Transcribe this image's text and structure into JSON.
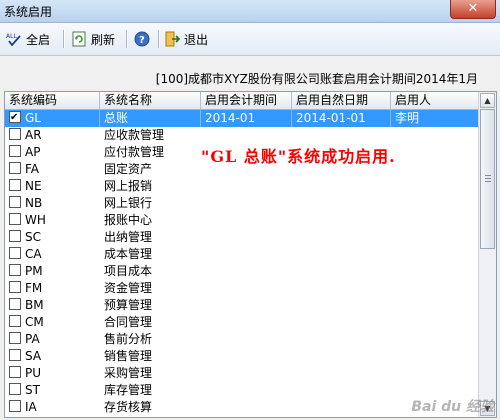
{
  "window": {
    "title": "系统启用",
    "close": "✕"
  },
  "toolbar": {
    "select_all": "全启",
    "refresh": "刷新",
    "exit": "退出",
    "all_icon_text": "ALL"
  },
  "info": "[100]成都市XYZ股份有限公司账套启用会计期间2014年1月",
  "columns": [
    "系统编码",
    "系统名称",
    "启用会计期间",
    "启用自然日期",
    "启用人"
  ],
  "rows": [
    {
      "code": "GL",
      "name": "总账",
      "period": "2014-01",
      "date": "2014-01-01",
      "user": "李明",
      "checked": true,
      "selected": true
    },
    {
      "code": "AR",
      "name": "应收款管理",
      "period": "",
      "date": "",
      "user": "",
      "checked": false
    },
    {
      "code": "AP",
      "name": "应付款管理",
      "period": "",
      "date": "",
      "user": "",
      "checked": false
    },
    {
      "code": "FA",
      "name": "固定资产",
      "period": "",
      "date": "",
      "user": "",
      "checked": false
    },
    {
      "code": "NE",
      "name": "网上报销",
      "period": "",
      "date": "",
      "user": "",
      "checked": false
    },
    {
      "code": "NB",
      "name": "网上银行",
      "period": "",
      "date": "",
      "user": "",
      "checked": false
    },
    {
      "code": "WH",
      "name": "报账中心",
      "period": "",
      "date": "",
      "user": "",
      "checked": false
    },
    {
      "code": "SC",
      "name": "出纳管理",
      "period": "",
      "date": "",
      "user": "",
      "checked": false
    },
    {
      "code": "CA",
      "name": "成本管理",
      "period": "",
      "date": "",
      "user": "",
      "checked": false
    },
    {
      "code": "PM",
      "name": "项目成本",
      "period": "",
      "date": "",
      "user": "",
      "checked": false
    },
    {
      "code": "FM",
      "name": "资金管理",
      "period": "",
      "date": "",
      "user": "",
      "checked": false
    },
    {
      "code": "BM",
      "name": "预算管理",
      "period": "",
      "date": "",
      "user": "",
      "checked": false
    },
    {
      "code": "CM",
      "name": "合同管理",
      "period": "",
      "date": "",
      "user": "",
      "checked": false
    },
    {
      "code": "PA",
      "name": "售前分析",
      "period": "",
      "date": "",
      "user": "",
      "checked": false
    },
    {
      "code": "SA",
      "name": "销售管理",
      "period": "",
      "date": "",
      "user": "",
      "checked": false
    },
    {
      "code": "PU",
      "name": "采购管理",
      "period": "",
      "date": "",
      "user": "",
      "checked": false
    },
    {
      "code": "ST",
      "name": "库存管理",
      "period": "",
      "date": "",
      "user": "",
      "checked": false
    },
    {
      "code": "IA",
      "name": "存货核算",
      "period": "",
      "date": "",
      "user": "",
      "checked": false
    }
  ],
  "message": "\"GL 总账\"系统成功启用.",
  "watermark": "Bai du 经验",
  "colors": {
    "selection": "#3399ff",
    "message": "#ff0000"
  }
}
